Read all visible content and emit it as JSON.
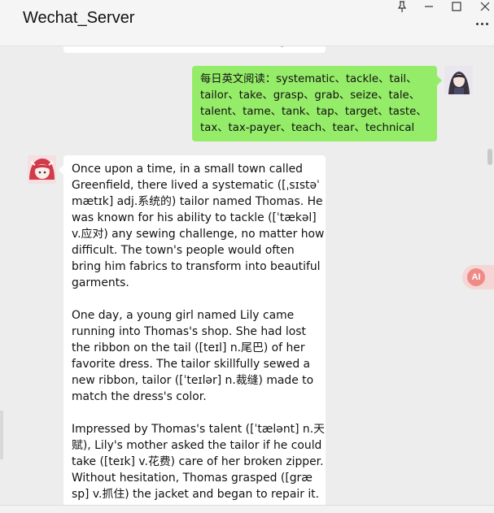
{
  "window": {
    "title": "Wechat_Server"
  },
  "icons": {
    "pin": "pin-icon",
    "minimize": "minimize-icon",
    "maximize": "maximize-icon",
    "close": "close-icon",
    "more": "more-icon",
    "ai": "ai-assistant-icon"
  },
  "ai_button": {
    "label": "AI"
  },
  "messages": {
    "user": {
      "lines": [
        "每日英文阅读：systematic、tackle、tail、",
        "tailor、take、grasp、grab、seize、tale、",
        "talent、tame、tank、tap、target、taste、",
        "tax、tax-payer、teach、tear、technical"
      ]
    },
    "bot": {
      "paragraph1": [
        "Once upon a time, in a small town called",
        "Greenfield, there lived a systematic ([ˌsɪstəˈ",
        "mætɪk] adj.系统的) tailor named Thomas. He",
        "was known for his ability to tackle ([ˈtækəl]",
        "v.应对) any sewing challenge, no matter how",
        "difficult. The town's people would often",
        "bring him fabrics to transform into beautiful",
        "garments."
      ],
      "paragraph2": [
        "One day, a young girl named Lily came",
        "running into Thomas's shop. She had lost",
        "the ribbon on the tail ([teɪl] n.尾巴) of her",
        "favorite dress. The tailor skillfully sewed a",
        "new ribbon, tailor ([ˈteɪlər] n.裁缝) made to",
        "match the dress's color."
      ],
      "paragraph3": [
        "Impressed by Thomas's talent ([ˈtælənt] n.天",
        "赋), Lily's mother asked the tailor if he could",
        "take ([teɪk] v.花费) care of her broken zipper.",
        "Without hesitation, Thomas grasped ([græ",
        "sp] v.抓住) the jacket and began to repair it."
      ]
    }
  },
  "colors": {
    "user_bubble": "#95ec69",
    "bot_bubble": "#ffffff",
    "chat_bg": "#ededed"
  }
}
